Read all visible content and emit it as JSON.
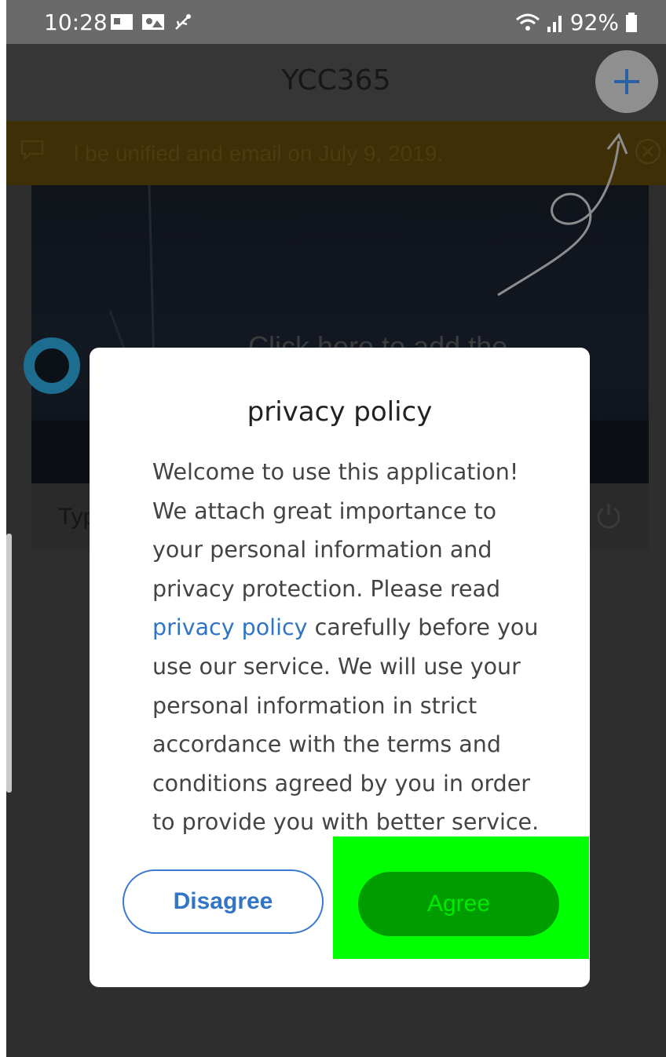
{
  "status_bar": {
    "time": "10:28",
    "battery": "92%",
    "signal_icons": [
      "wifi-icon",
      "signal-icon"
    ],
    "notification_icons": [
      "photo-icon",
      "gallery-icon",
      "usb-icon"
    ]
  },
  "app_bar": {
    "title": "YCC365",
    "add_icon": "plus-icon"
  },
  "notice": {
    "text": "l be unified and email on July 9, 2019."
  },
  "device_card": {
    "hint": "Click here to add the",
    "label": "Typ"
  },
  "dialog": {
    "title": "privacy policy",
    "body_before_link": "Welcome to use this application! We attach great importance to your personal information and privacy protection. Please read ",
    "link_text": "privacy policy",
    "body_after_link": " carefully before you use our service. We will use your personal information in strict accordance with the terms and conditions agreed by you in order to provide you with better service.",
    "disagree_label": "Disagree",
    "agree_label": "Agree"
  },
  "colors": {
    "accent": "#3275c6",
    "agree_button": "#009c00",
    "highlight": "#00ff00"
  }
}
